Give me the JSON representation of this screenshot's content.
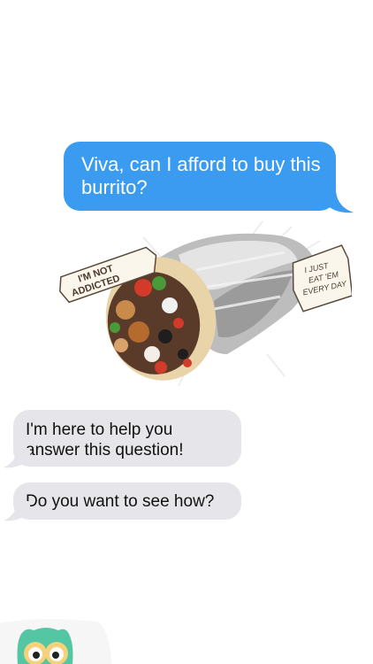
{
  "messages": [
    {
      "direction": "outgoing",
      "text": "Viva, can I afford to buy this burrito?"
    },
    {
      "direction": "incoming",
      "text": "I'm here to help you answer this question!"
    },
    {
      "direction": "incoming",
      "text": "Do you want to see how?"
    }
  ],
  "image_attachment": {
    "left_banner_text": "I'M NOT ADDICTED",
    "right_banner_text": "I JUST EAT 'EM EVERY DAY"
  },
  "colors": {
    "outgoing_bubble": "#3a9bf0",
    "incoming_bubble": "#e6e6ea",
    "owl_green": "#55c6a4"
  },
  "icons": [
    "burrito-image",
    "owl-avatar-icon"
  ]
}
